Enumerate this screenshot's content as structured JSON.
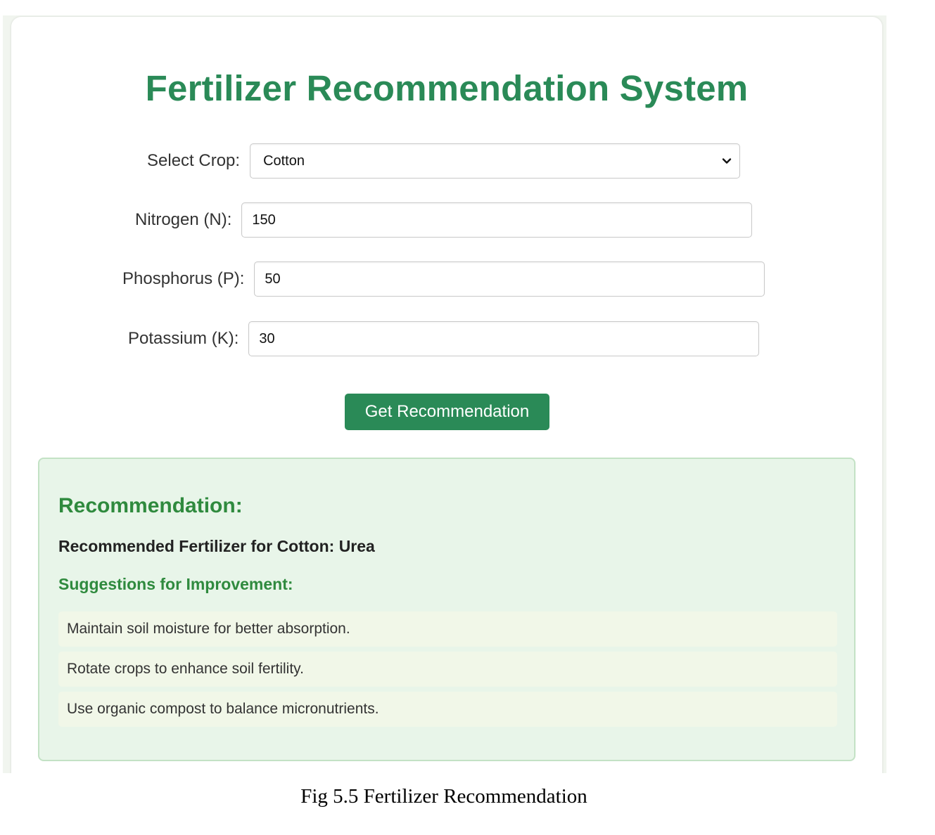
{
  "page": {
    "title": "Fertilizer Recommendation System",
    "brand_color": "#2a8a57"
  },
  "form": {
    "crop": {
      "label": "Select Crop:",
      "selected": "Cotton",
      "icon": "chevron-down-icon"
    },
    "nitrogen": {
      "label": "Nitrogen (N):",
      "value": "150"
    },
    "phosphorus": {
      "label": "Phosphorus (P):",
      "value": "50"
    },
    "potassium": {
      "label": "Potassium (K):",
      "value": "30"
    },
    "submit_label": "Get Recommendation"
  },
  "result": {
    "heading": "Recommendation:",
    "recommended_text": "Recommended Fertilizer for Cotton: Urea",
    "suggestions_heading": "Suggestions for Improvement:",
    "suggestions": [
      "Maintain soil moisture for better absorption.",
      "Rotate crops to enhance soil fertility.",
      "Use organic compost to balance micronutrients."
    ],
    "background_color": "#e8f5e9",
    "accent_color": "#2f8a3e"
  },
  "caption": "Fig 5.5 Fertilizer Recommendation"
}
